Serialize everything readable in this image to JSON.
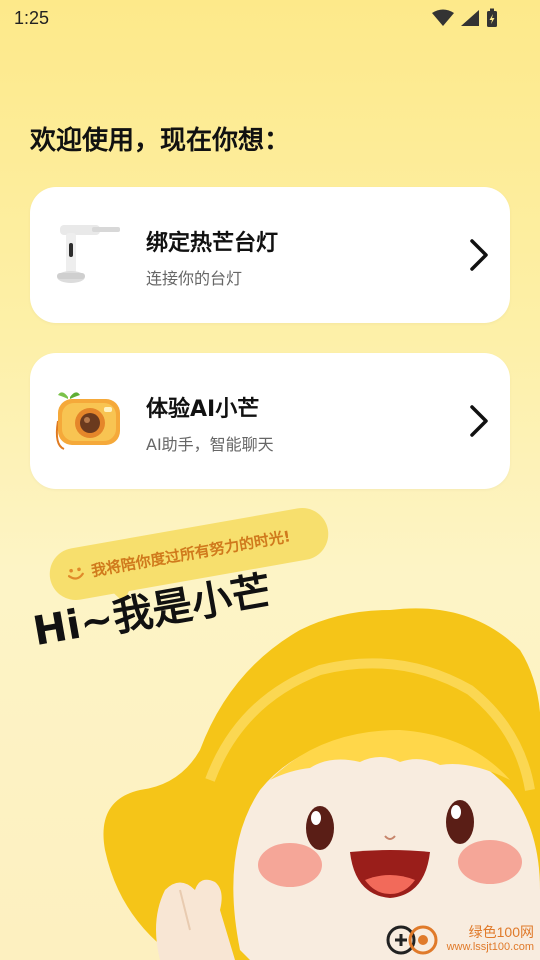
{
  "status_bar": {
    "time": "1:25"
  },
  "heading": "欢迎使用，现在你想：",
  "cards": [
    {
      "title": "绑定热芒台灯",
      "subtitle": "连接你的台灯",
      "thumb_icon": "desk-lamp-icon"
    },
    {
      "title": "体验AI小芒",
      "subtitle": "AI助手，智能聊天",
      "thumb_icon": "camera-mascot-icon"
    }
  ],
  "speech_bubble": "我将陪你度过所有努力的时光!",
  "greeting": "Hi~我是小芒",
  "watermark": {
    "line1": "绿色100网",
    "line2": "www.lssjt100.com"
  },
  "colors": {
    "accent": "#f7df6d",
    "bubble_text": "#d07a1c",
    "mascot_yellow": "#f5c518"
  }
}
